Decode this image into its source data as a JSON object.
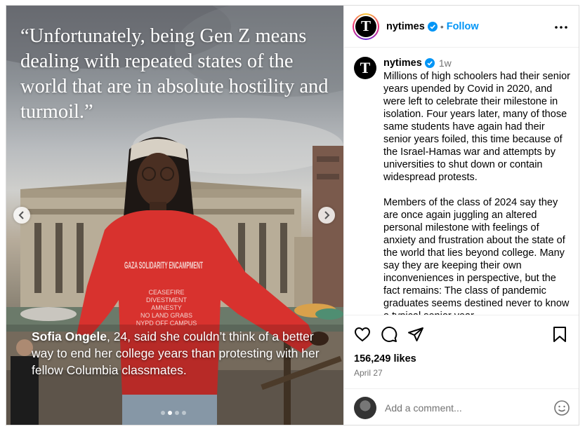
{
  "media": {
    "quote": "“Unfortunately, being Gen Z means dealing with repeated states of the world that are in absolute hostility and turmoil.”",
    "caption_name": "Sofia Ongele",
    "caption_rest": ", 24, said she couldn’t think of a better way to end her college years than protesting with her fellow Columbia classmates.",
    "sweatshirt_text": "GAZA SOLIDARITY ENCAMPMENT",
    "sweatshirt_lines": [
      "CEASEFIRE",
      "DIVESTMENT",
      "AMNESTY",
      "NO LAND GRABS",
      "NYPD OFF CAMPUS"
    ],
    "slide_count": 4,
    "active_slide": 2
  },
  "header": {
    "avatar_glyph": "T",
    "username": "nytimes",
    "separator": "•",
    "follow_label": "Follow"
  },
  "caption_post": {
    "username": "nytimes",
    "time": "1w",
    "paragraph1": "Millions of high schoolers had their senior years upended by Covid in 2020, and were left to celebrate their milestone in isolation. Four years later, many of those same students have again had their senior years foiled, this time because of the Israel-Hamas war and attempts by universities to shut down or contain widespread protests.",
    "paragraph2": "Members of the class of 2024 say they are once again juggling an altered personal milestone with feelings of anxiety and frustration about the state of the world that lies beyond college. Many say they are keeping their own inconveniences in perspective, but the fact remains: The class of pandemic graduates seems destined never to know a typical senior year."
  },
  "actions": {
    "likes": "156,249 likes",
    "date": "April 27"
  },
  "comment_box": {
    "placeholder": "Add a comment..."
  },
  "colors": {
    "accent": "#0095f6",
    "verified": "#0095f6",
    "secondary_text": "#737373",
    "sweatshirt": "#d8322e"
  },
  "icons": [
    "verified-badge-icon",
    "more-options-icon",
    "heart-icon",
    "comment-icon",
    "share-icon",
    "bookmark-icon",
    "emoji-icon",
    "chevron-left-icon",
    "chevron-right-icon"
  ]
}
